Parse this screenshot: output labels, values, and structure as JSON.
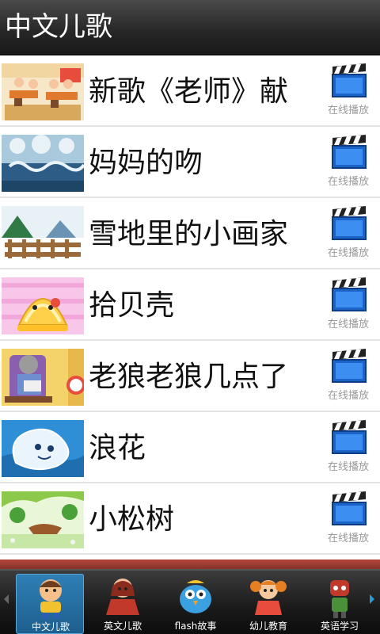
{
  "app": {
    "title": "中文儿歌"
  },
  "songs": [
    {
      "title": "新歌《老师》献",
      "action_label": "在线播放",
      "thumb_icon": "classroom-thumbnail"
    },
    {
      "title": "妈妈的吻",
      "action_label": "在线播放",
      "thumb_icon": "winter-forest-thumbnail"
    },
    {
      "title": "雪地里的小画家",
      "action_label": "在线播放",
      "thumb_icon": "snowy-fence-thumbnail"
    },
    {
      "title": "拾贝壳",
      "action_label": "在线播放",
      "thumb_icon": "shell-face-thumbnail"
    },
    {
      "title": "老狼老狼几点了",
      "action_label": "在线播放",
      "thumb_icon": "grandma-wolf-thumbnail"
    },
    {
      "title": "浪花",
      "action_label": "在线播放",
      "thumb_icon": "wave-face-thumbnail"
    },
    {
      "title": "小松树",
      "action_label": "在线播放",
      "thumb_icon": "pine-tree-thumbnail"
    }
  ],
  "tabs": [
    {
      "label": "中文儿歌",
      "icon": "boy-character-icon",
      "selected": true
    },
    {
      "label": "英文儿歌",
      "icon": "girl-character-icon",
      "selected": false
    },
    {
      "label": "flash故事",
      "icon": "bird-character-icon",
      "selected": false
    },
    {
      "label": "幼儿教育",
      "icon": "pigtail-girl-icon",
      "selected": false
    },
    {
      "label": "英语学习",
      "icon": "robot-character-icon",
      "selected": false
    }
  ],
  "colors": {
    "accent": "#2a9bd8",
    "selected_tab": "#1d5f8e",
    "play_icon": "#1c63c8"
  }
}
